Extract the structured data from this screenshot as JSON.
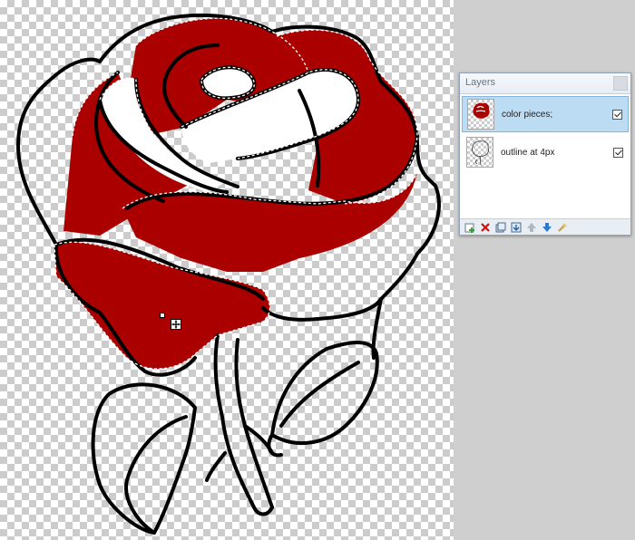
{
  "layers_panel": {
    "title": "Layers",
    "layers": [
      {
        "name": "color pieces;",
        "visible": true,
        "selected": true
      },
      {
        "name": "outline at 4px",
        "visible": true,
        "selected": false
      }
    ],
    "toolbar_icons": [
      "add-layer-icon",
      "delete-layer-icon",
      "duplicate-layer-icon",
      "merge-down-icon",
      "move-up-icon",
      "move-down-icon",
      "properties-icon"
    ]
  },
  "colors": {
    "fill": "#aa0000",
    "selection_bg": "#bcdcf4"
  }
}
